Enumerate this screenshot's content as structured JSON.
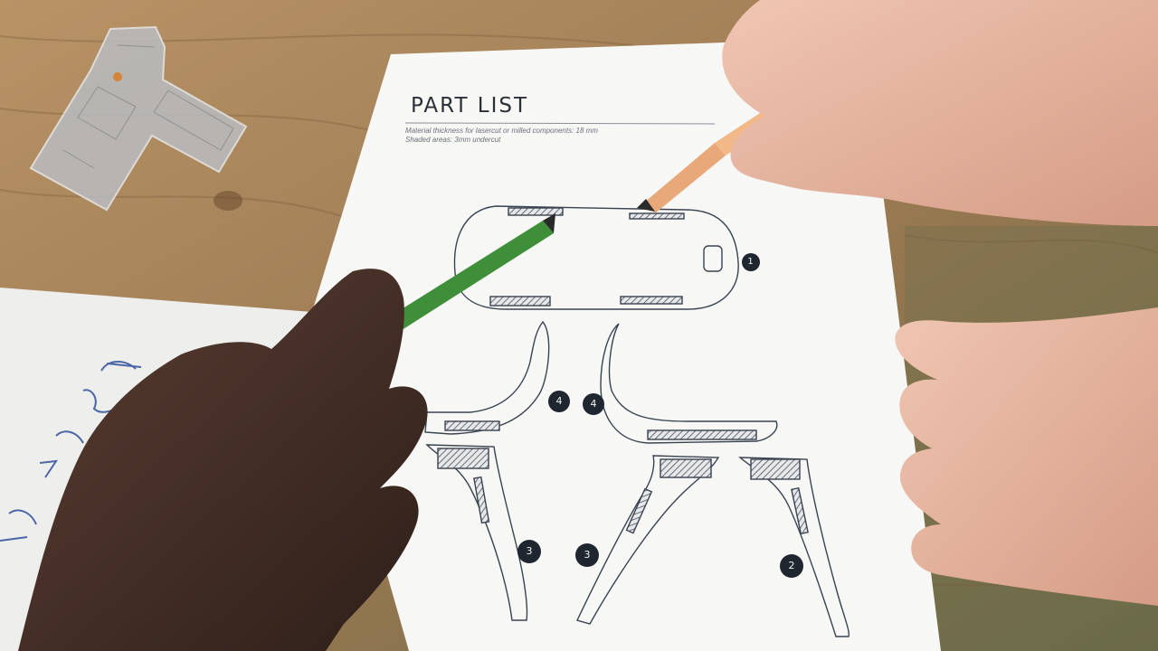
{
  "sheet": {
    "title": "PART LIST",
    "notes": [
      "Material thickness for lasercut or milled components: 18 mm",
      "Shaded areas: 3mm undercut"
    ]
  },
  "parts": [
    {
      "id": "part-1",
      "label": "1"
    },
    {
      "id": "part-2",
      "label": "2"
    },
    {
      "id": "part-3a",
      "label": "3"
    },
    {
      "id": "part-3b",
      "label": "3"
    },
    {
      "id": "part-4a",
      "label": "4"
    },
    {
      "id": "part-4b",
      "label": "4"
    }
  ],
  "colors": {
    "table_wood": "#9a7a55",
    "paper": "#f7f7f5",
    "ink": "#2b2f36",
    "badge": "#1f2630",
    "pencil_green": "#3f8f3a",
    "pencil_orange": "#e8a87a",
    "skin_light": "#e7b8a2",
    "skin_dark": "#3e2a22",
    "floor_plan_overlay": "#b9bcc1",
    "location_marker": "#d98432"
  }
}
